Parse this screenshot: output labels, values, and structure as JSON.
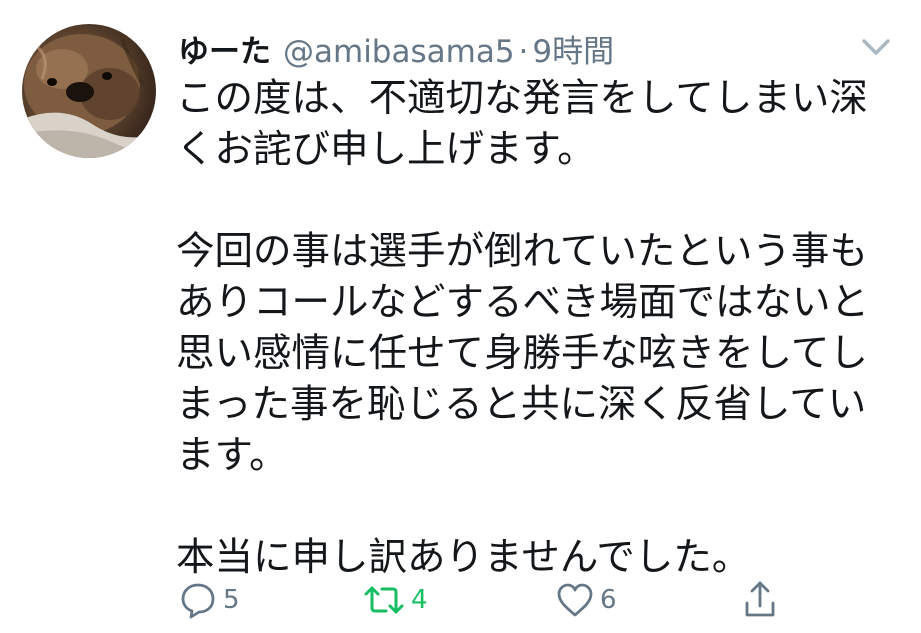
{
  "tweet": {
    "display_name": "ゆーた",
    "handle": "@amibasama5",
    "separator": "·",
    "timestamp": "9時間",
    "avatar_icon": "dog-avatar",
    "menu_icon": "chevron-down-icon",
    "paragraphs": [
      [
        "この度は、不適切な発言をしてしまい深",
        "くお詫び申し上げます。"
      ],
      [
        "今回の事は選手が倒れていたという事も",
        "ありコールなどするべき場面ではないと",
        "思い感情に任せて身勝手な呟きをしてし",
        "まった事を恥じると共に深く反省してい",
        "ます。"
      ],
      [
        "本当に申し訳ありませんでした。"
      ]
    ]
  },
  "actions": {
    "reply": {
      "icon": "reply-icon",
      "count": "5"
    },
    "retweet": {
      "icon": "retweet-icon",
      "count": "4",
      "color": "#17bf63"
    },
    "like": {
      "icon": "heart-icon",
      "count": "6"
    },
    "share": {
      "icon": "share-icon"
    }
  },
  "colors": {
    "text": "#14171a",
    "secondary": "#657786",
    "retweet_active": "#17bf63"
  }
}
